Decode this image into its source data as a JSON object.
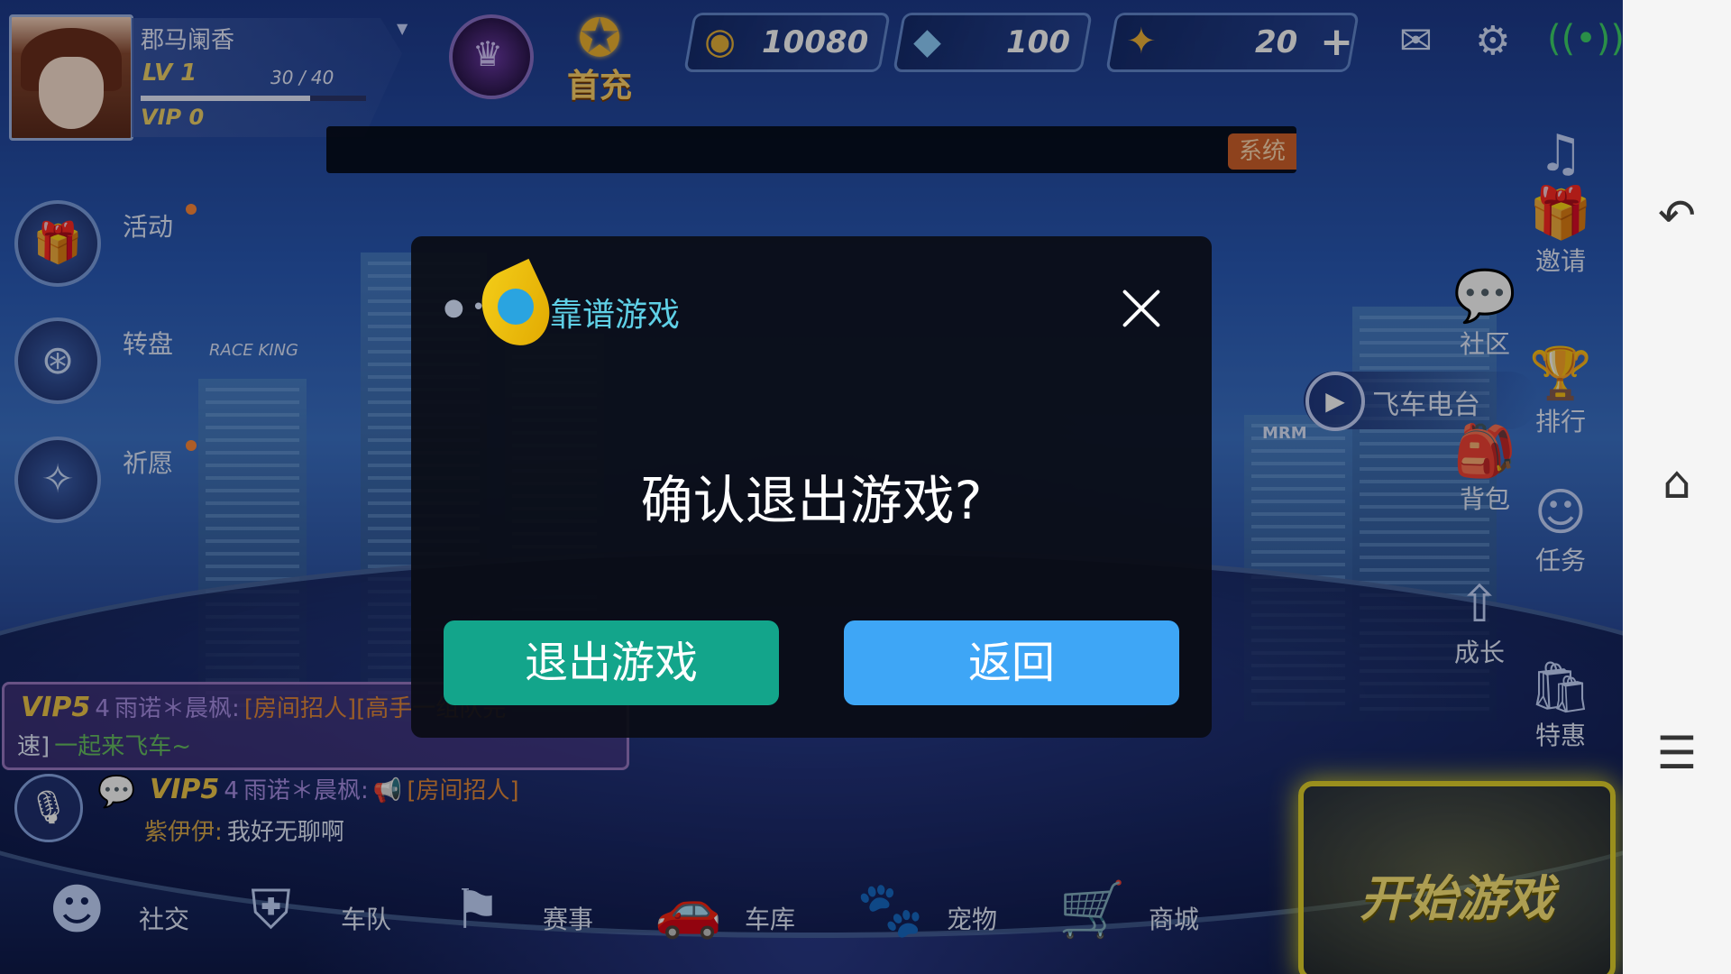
{
  "player": {
    "name": "郡马阑香",
    "level_text": "LV 1",
    "xp_current": 30,
    "xp_sep": "/",
    "xp_max": 40,
    "xp_fraction": 0.75,
    "vip_text": "VIP 0"
  },
  "top": {
    "first_charge_label": "首充",
    "gold": "10080",
    "diamonds": "100",
    "tickets": "20",
    "announcement_tag": "系统"
  },
  "left_menu": {
    "activity": "活动",
    "wheel": "转盘",
    "wish": "祈愿"
  },
  "right_menu": {
    "invite": "邀请",
    "community": "社区",
    "radio": "飞车电台",
    "rank": "排行",
    "backpack": "背包",
    "tasks": "任务",
    "growth": "成长",
    "special": "特惠"
  },
  "chat": {
    "line1_vip": "VIP5",
    "line1_level": "4",
    "line1_nick": "雨诺＊晨枫",
    "line1_msg": "[房间招人][高手一组队完",
    "line1_msg2_prefix": "速]",
    "line1_msg2": "一起来飞车~",
    "line2_vip": "VIP5",
    "line2_level": "4",
    "line2_nick": "雨诺＊晨枫",
    "line2_msg": "[房间招人]",
    "line3_nick": "紫伊伊",
    "line3_msg": "我好无聊啊"
  },
  "bottom_nav": {
    "social": "社交",
    "team": "车队",
    "events": "赛事",
    "garage": "车库",
    "pets": "宠物",
    "shop": "商城",
    "start": "开始游戏"
  },
  "scene": {
    "sign_left": "RACE KING",
    "sign_right": "MRM"
  },
  "dialog": {
    "brand": "靠谱游戏",
    "message": "确认退出游戏?",
    "exit_button": "退出游戏",
    "back_button": "返回"
  },
  "colors": {
    "exit_button": "#13a58b",
    "back_button": "#3ea6f6",
    "gold_text": "#f1d36b",
    "start_border": "#e3d32c"
  },
  "icons": {
    "back": "back-arrow-icon",
    "home": "home-icon",
    "menu": "menu-icon"
  }
}
